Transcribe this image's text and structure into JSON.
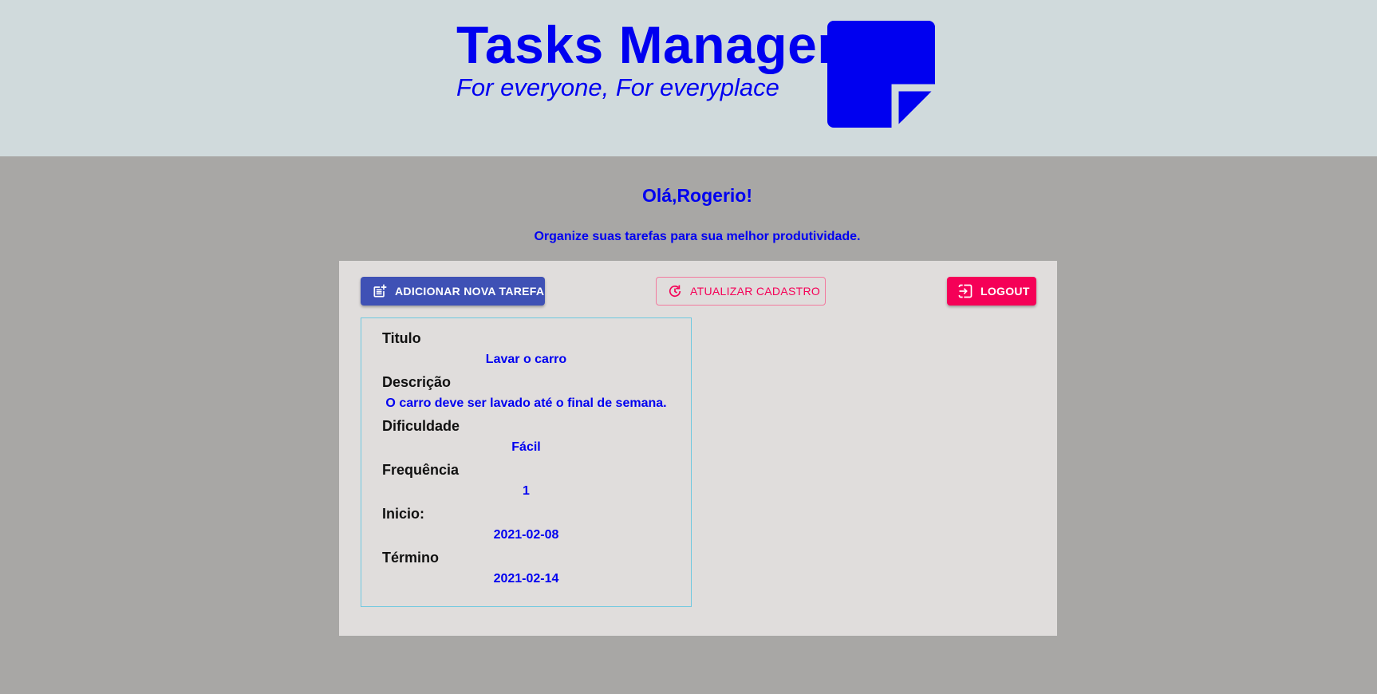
{
  "header": {
    "title": "Tasks Manager",
    "tagline": "For everyone, For everyplace",
    "logo_icon": "sticky-note-icon",
    "brand_color": "#0000f0"
  },
  "greeting": "Olá,Rogerio!",
  "subtitle": "Organize suas tarefas para sua melhor produtividade.",
  "toolbar": {
    "add_label": "ADICIONAR NOVA TAREFA",
    "add_icon": "post-add-icon",
    "add_color": "#3f51b5",
    "update_label": "ATUALIZAR CADASTRO",
    "update_icon": "refresh-icon",
    "logout_label": "LOGOUT",
    "logout_icon": "exit-icon",
    "logout_color": "#f50057"
  },
  "task": {
    "title_label": "Titulo",
    "title_value": "Lavar o carro",
    "description_label": "Descrição",
    "description_value": "O carro deve ser lavado até o final de semana.",
    "difficulty_label": "Dificuldade",
    "difficulty_value": "Fácil",
    "frequency_label": "Frequência",
    "frequency_value": "1",
    "start_label": "Inicio:",
    "start_value": "2021-02-08",
    "end_label": "Término",
    "end_value": "2021-02-14"
  }
}
